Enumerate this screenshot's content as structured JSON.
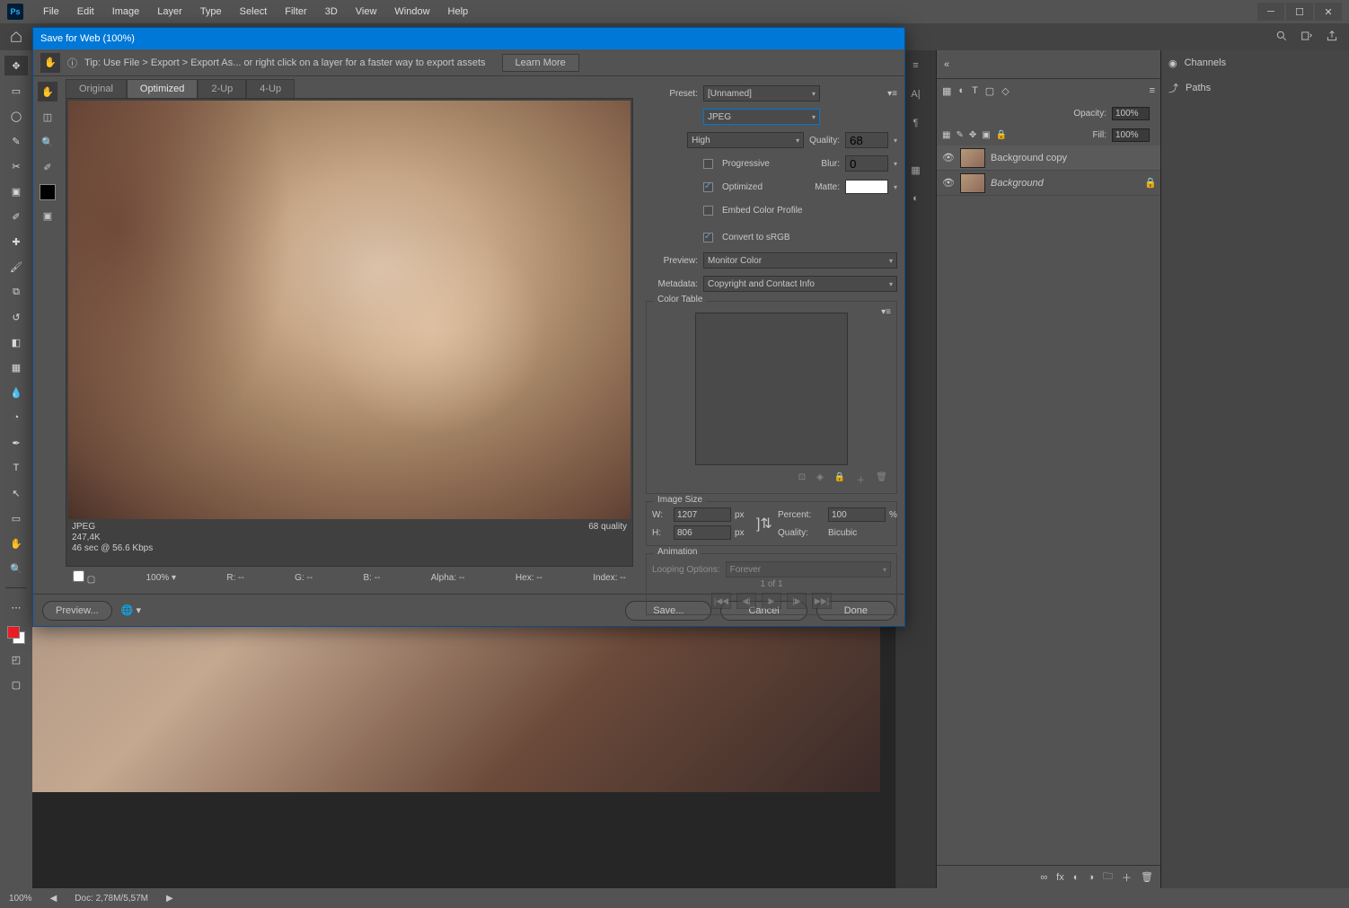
{
  "menubar": {
    "items": [
      "File",
      "Edit",
      "Image",
      "Layer",
      "Type",
      "Select",
      "Filter",
      "3D",
      "View",
      "Window",
      "Help"
    ]
  },
  "dialog": {
    "title": "Save for Web (100%)",
    "tip": "Tip: Use File > Export > Export As...   or right click on a layer for a faster way to export assets",
    "learn_more": "Learn More",
    "tabs": {
      "original": "Original",
      "optimized": "Optimized",
      "two_up": "2-Up",
      "four_up": "4-Up"
    },
    "info": {
      "format": "JPEG",
      "size": "247,4K",
      "timing": "46 sec @ 56.6 Kbps",
      "quality_text": "68 quality"
    },
    "zoom": "100%",
    "readout": {
      "r": "R: --",
      "g": "G: --",
      "b": "B: --",
      "alpha": "Alpha: --",
      "hex": "Hex: --",
      "index": "Index: --"
    },
    "settings": {
      "preset_label": "Preset:",
      "preset_value": "[Unnamed]",
      "format": "JPEG",
      "quality_dd": "High",
      "quality_label": "Quality:",
      "quality_value": "68",
      "progressive": "Progressive",
      "blur_label": "Blur:",
      "blur_value": "0",
      "optimized": "Optimized",
      "matte_label": "Matte:",
      "embed": "Embed Color Profile",
      "convert_srgb": "Convert to sRGB",
      "preview_label": "Preview:",
      "preview_value": "Monitor Color",
      "metadata_label": "Metadata:",
      "metadata_value": "Copyright and Contact Info",
      "color_table": "Color Table",
      "image_size": "Image Size",
      "w_label": "W:",
      "w_value": "1207",
      "px": "px",
      "h_label": "H:",
      "h_value": "806",
      "percent_label": "Percent:",
      "percent_value": "100",
      "percent_unit": "%",
      "iq_label": "Quality:",
      "iq_value": "Bicubic",
      "animation": "Animation",
      "looping_label": "Looping Options:",
      "looping_value": "Forever",
      "frame_text": "1 of 1"
    },
    "footer": {
      "preview": "Preview...",
      "save": "Save...",
      "cancel": "Cancel",
      "done": "Done"
    }
  },
  "right": {
    "channels": "Channels",
    "paths": "Paths",
    "opacity_label": "Opacity:",
    "opacity_value": "100%",
    "fill_label": "Fill:",
    "fill_value": "100%",
    "layers": [
      {
        "name": "Background copy",
        "locked": false
      },
      {
        "name": "Background",
        "locked": true
      }
    ]
  },
  "status": {
    "zoom": "100%",
    "doc": "Doc: 2,78M/5,57M"
  }
}
